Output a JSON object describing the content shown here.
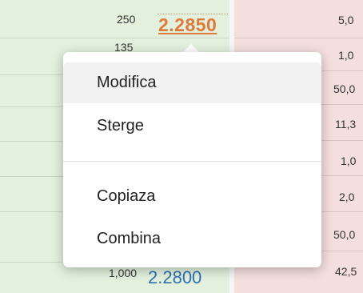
{
  "order_book": {
    "top_row": {
      "quantity": "250",
      "price": "2.2850"
    },
    "obscured_row_quantity": "135",
    "bottom_row": {
      "quantity": "1,000",
      "price": "2.2800"
    },
    "right_column_values": [
      "5,0",
      "1,0",
      "50,0",
      "11,3",
      "1,0",
      "2,0",
      "50,0",
      "42,5"
    ]
  },
  "context_menu": {
    "items": [
      {
        "label": "Modifica",
        "highlighted": true
      },
      {
        "label": "Sterge",
        "highlighted": false
      },
      {
        "label": "Copiaza",
        "highlighted": false
      },
      {
        "label": "Combina",
        "highlighted": false
      }
    ]
  },
  "colors": {
    "bid_background": "#e2f0dd",
    "ask_background": "#f4dede",
    "selected_price": "#e07a3a",
    "price_blue": "#2f6fb3"
  }
}
